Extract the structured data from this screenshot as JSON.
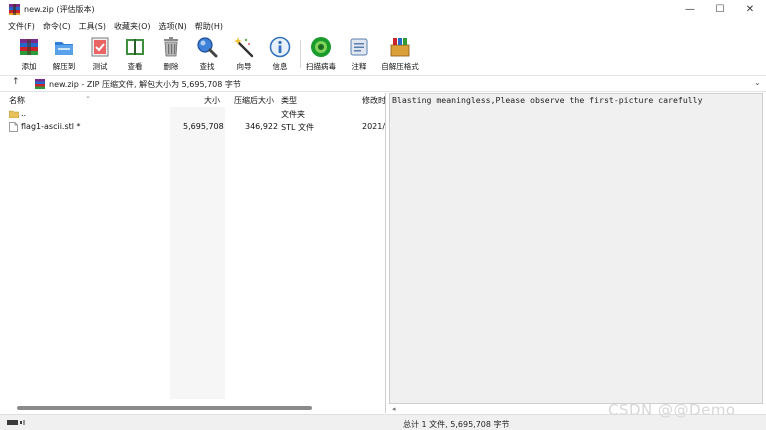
{
  "window": {
    "title": "new.zip (评估版本)",
    "controls": {
      "minimize": "—",
      "maximize": "☐",
      "close": "✕"
    }
  },
  "menu": [
    "文件(F)",
    "命令(C)",
    "工具(S)",
    "收藏夹(O)",
    "选项(N)",
    "帮助(H)"
  ],
  "toolbar": {
    "items": [
      {
        "label": "添加",
        "icon": "add-archive-icon"
      },
      {
        "label": "解压到",
        "icon": "extract-to-icon"
      },
      {
        "label": "测试",
        "icon": "test-icon"
      },
      {
        "label": "查看",
        "icon": "view-icon"
      },
      {
        "label": "删除",
        "icon": "delete-icon"
      },
      {
        "label": "查找",
        "icon": "find-icon"
      },
      {
        "label": "向导",
        "icon": "wizard-icon"
      },
      {
        "label": "信息",
        "icon": "info-icon"
      },
      {
        "label": "扫描病毒",
        "icon": "virus-scan-icon"
      },
      {
        "label": "注释",
        "icon": "comment-icon"
      },
      {
        "label": "自解压格式",
        "icon": "sfx-icon"
      }
    ]
  },
  "address": {
    "up": "↑",
    "path": "new.zip - ZIP 压缩文件, 解包大小为 5,695,708 字节",
    "dropdown": "⌄"
  },
  "columns": {
    "name": "名称",
    "size": "大小",
    "packed": "压缩后大小",
    "type": "类型",
    "modified": "修改时"
  },
  "rows": [
    {
      "name": "..",
      "size": "",
      "packed": "",
      "type": "文件夹",
      "modified": "",
      "kind": "folder"
    },
    {
      "name": "flag1-ascii.stl *",
      "size": "5,695,708",
      "packed": "346,922",
      "type": "STL 文件",
      "modified": "2021/",
      "kind": "file"
    }
  ],
  "preview": {
    "text": "Blasting meaningless,Please observe the first-picture carefully"
  },
  "status": {
    "summary": "总计 1 文件, 5,695,708 字节"
  },
  "watermark": "CSDN @@Demo",
  "colors": {
    "accent_blue": "#1e6fd9",
    "accent_green": "#1a9b2c",
    "pane_bg": "#f0f0f0"
  }
}
